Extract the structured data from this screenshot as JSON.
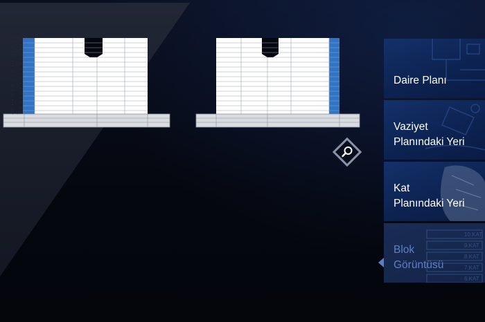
{
  "colors": {
    "background": "#05070f",
    "menu_bg": "#0c2250",
    "active_text": "#5f7fc4",
    "selected_unit": "#2f74c7",
    "floor_white": "#ffffff"
  },
  "menu": {
    "items": [
      {
        "label": "Daire Planı",
        "active": false
      },
      {
        "label": "Vaziyet\nPlanındaki Yeri",
        "active": false
      },
      {
        "label": "Kat\nPlanındaki Yeri",
        "active": false
      },
      {
        "label": "Blok\nGörüntüsü",
        "active": true
      }
    ]
  },
  "zoom": {
    "icon": "magnifier-icon"
  },
  "menu_decor_tags": [
    "10.KAT",
    "9.KAT",
    "8.KAT",
    "7.KAT",
    "6.KAT"
  ]
}
